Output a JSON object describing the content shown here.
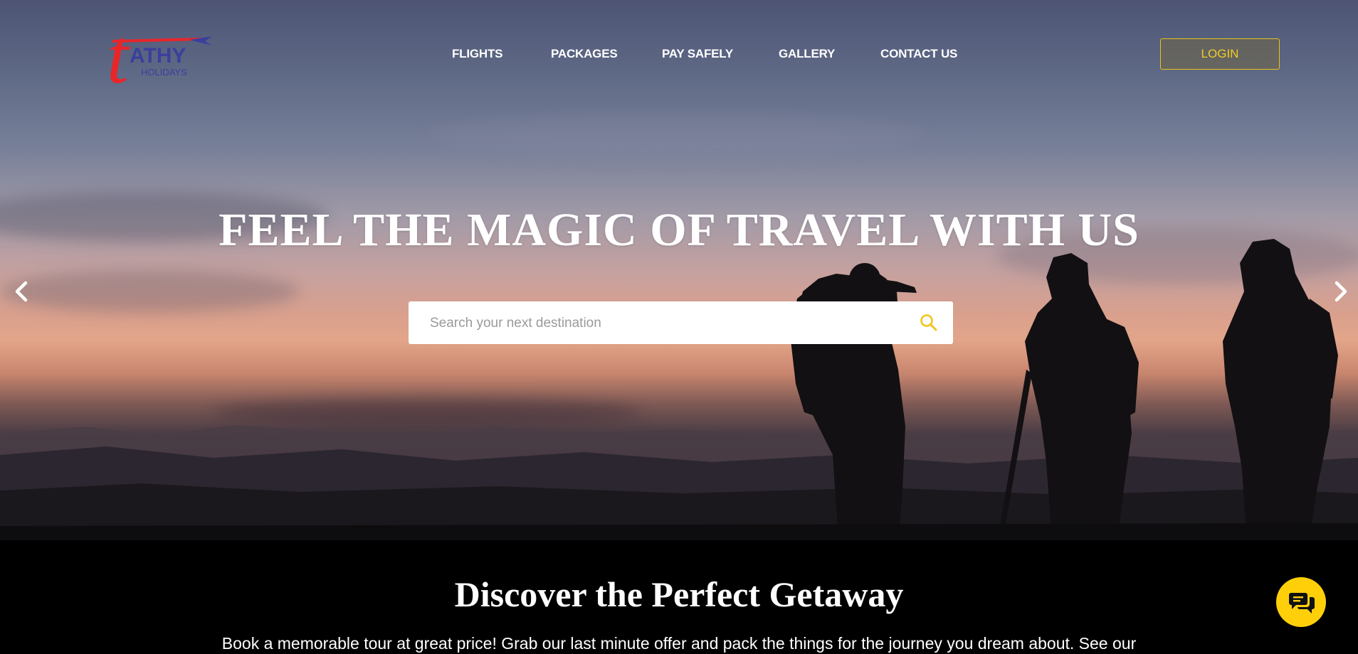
{
  "brand": {
    "logo_text_main": "ATHY",
    "logo_text_sub": "HOLIDAYS",
    "logo_letter": "t"
  },
  "nav": {
    "items": [
      {
        "label": "FLIGHTS"
      },
      {
        "label": "PACKAGES"
      },
      {
        "label": "PAY SAFELY"
      },
      {
        "label": "GALLERY"
      },
      {
        "label": "CONTACT US"
      }
    ],
    "login_label": "LOGIN"
  },
  "hero": {
    "title": "FEEL THE MAGIC OF TRAVEL WITH US",
    "search": {
      "placeholder": "Search your next destination",
      "value": ""
    }
  },
  "section": {
    "title": "Discover the Perfect Getaway",
    "text": "Book a memorable tour at great price! Grab our last minute offer and pack the things for the journey you dream about. See our"
  },
  "icons": {
    "search": "search-icon",
    "prev": "chevron-left-icon",
    "next": "chevron-right-icon",
    "chat": "chat-icon"
  },
  "colors": {
    "accent": "#ffd00a",
    "login_border": "#e9c21f",
    "logo_red": "#e8262a",
    "logo_blue": "#3b3f9c"
  }
}
